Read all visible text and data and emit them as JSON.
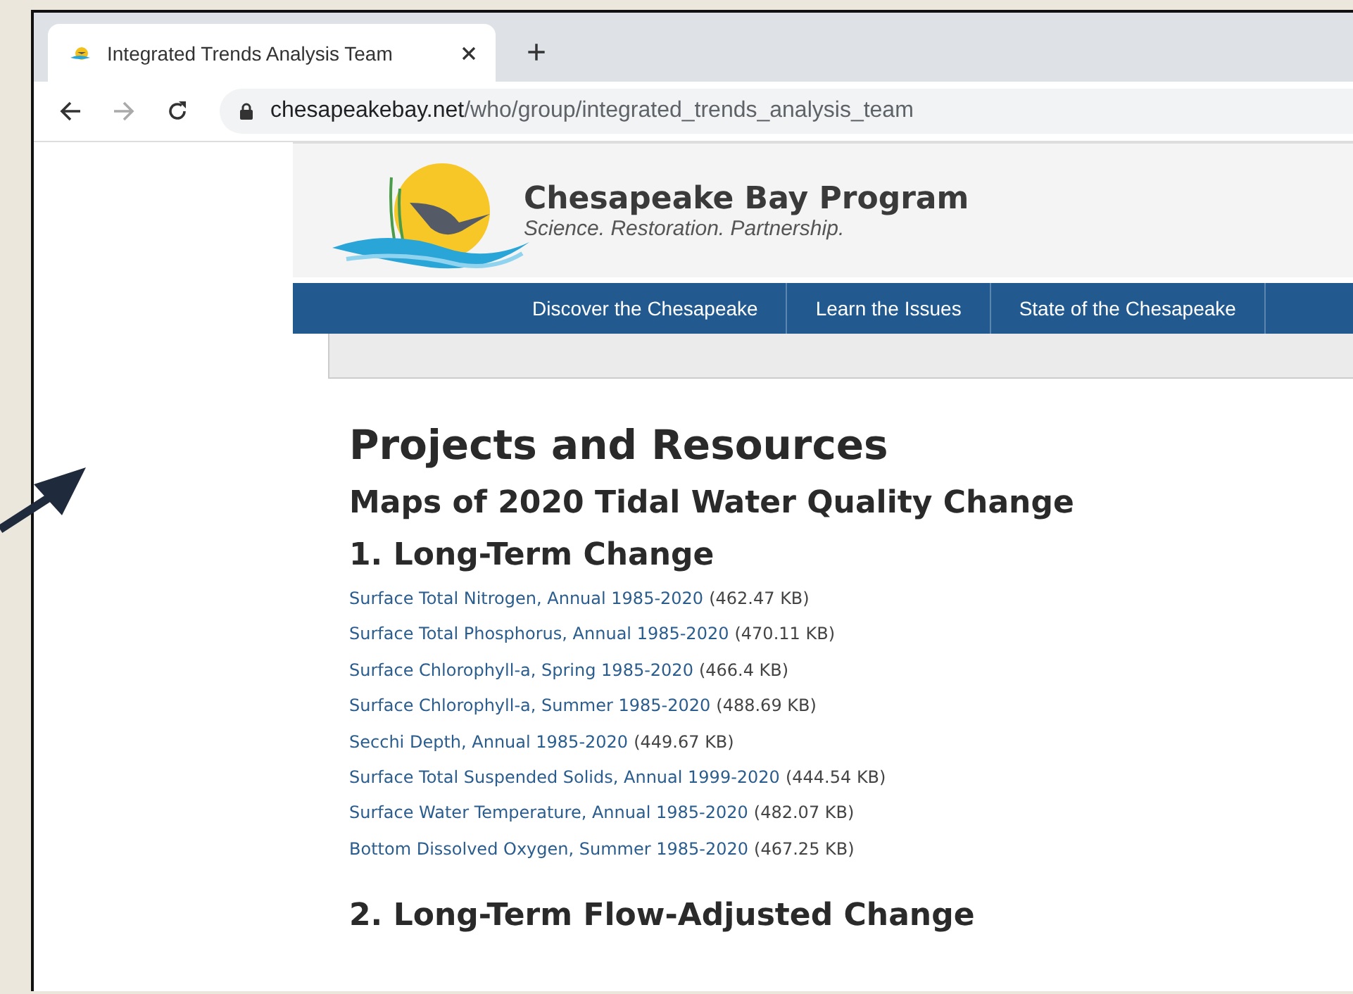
{
  "browser": {
    "tab": {
      "title": "Integrated Trends Analysis Team",
      "selected": true
    },
    "new_tab": "+",
    "url_domain": "chesapeakebay.net",
    "url_path": "/who/group/integrated_trends_analysis_team"
  },
  "site": {
    "name": "Chesapeake Bay Program",
    "tagline": "Science. Restoration. Partnership.",
    "nav": [
      "Discover the Chesapeake",
      "Learn the Issues",
      "State of the Chesapeake"
    ]
  },
  "content": {
    "title": "Projects and Resources",
    "subtitle": "Maps of 2020 Tidal Water Quality Change",
    "sections": [
      {
        "heading": "1. Long-Term Change",
        "files": [
          {
            "link": "Surface Total Nitrogen, Annual 1985-2020",
            "size": "(462.47 KB)"
          },
          {
            "link": "Surface Total Phosphorus, Annual 1985-2020",
            "size": "(470.11 KB)"
          },
          {
            "link": "Surface Chlorophyll-a, Spring 1985-2020",
            "size": "(466.4 KB)"
          },
          {
            "link": "Surface Chlorophyll-a, Summer 1985-2020",
            "size": "(488.69 KB)"
          },
          {
            "link": "Secchi Depth, Annual 1985-2020",
            "size": "(449.67 KB)"
          },
          {
            "link": "Surface Total Suspended Solids, Annual 1999-2020",
            "size": "(444.54 KB)"
          },
          {
            "link": "Surface Water Temperature, Annual 1985-2020",
            "size": "(482.07 KB)"
          },
          {
            "link": "Bottom Dissolved Oxygen, Summer 1985-2020",
            "size": "(467.25 KB)"
          }
        ]
      },
      {
        "heading": "2. Long-Term Flow-Adjusted Change"
      }
    ]
  }
}
